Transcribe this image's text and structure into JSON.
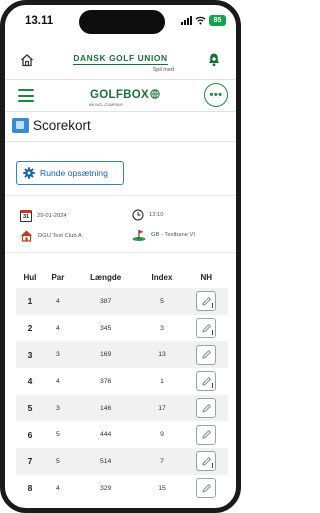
{
  "status": {
    "time": "13.11",
    "battery": "85"
  },
  "dgu": {
    "title": "DANSK GOLF UNION",
    "subtitle": "Spil med"
  },
  "golfbox": {
    "logo_text": "GOLFBOX",
    "company": "AN MCL COMPANY"
  },
  "page": {
    "title": "Scorekort"
  },
  "setup_button": {
    "label": "Runde opsætning"
  },
  "round_info": {
    "date": "29-01-2024",
    "calendar_day": "31",
    "time": "13:10",
    "club": "DGU Test Club A",
    "course": "GB - Testbane VI"
  },
  "table": {
    "headers": [
      "Hul",
      "Par",
      "Længde",
      "Index",
      "NH"
    ],
    "rows": [
      {
        "hole": "1",
        "par": "4",
        "length": "387",
        "index": "5",
        "nh_marked": true
      },
      {
        "hole": "2",
        "par": "4",
        "length": "345",
        "index": "3",
        "nh_marked": true
      },
      {
        "hole": "3",
        "par": "3",
        "length": "169",
        "index": "13",
        "nh_marked": false
      },
      {
        "hole": "4",
        "par": "4",
        "length": "376",
        "index": "1",
        "nh_marked": true
      },
      {
        "hole": "5",
        "par": "3",
        "length": "146",
        "index": "17",
        "nh_marked": false
      },
      {
        "hole": "6",
        "par": "5",
        "length": "444",
        "index": "9",
        "nh_marked": false
      },
      {
        "hole": "7",
        "par": "5",
        "length": "514",
        "index": "7",
        "nh_marked": true
      },
      {
        "hole": "8",
        "par": "4",
        "length": "329",
        "index": "15",
        "nh_marked": false
      }
    ]
  },
  "colors": {
    "brand_green": "#1f8a3c",
    "accent_blue": "#1d5fae",
    "row_stripe": "#f1f1f1"
  }
}
